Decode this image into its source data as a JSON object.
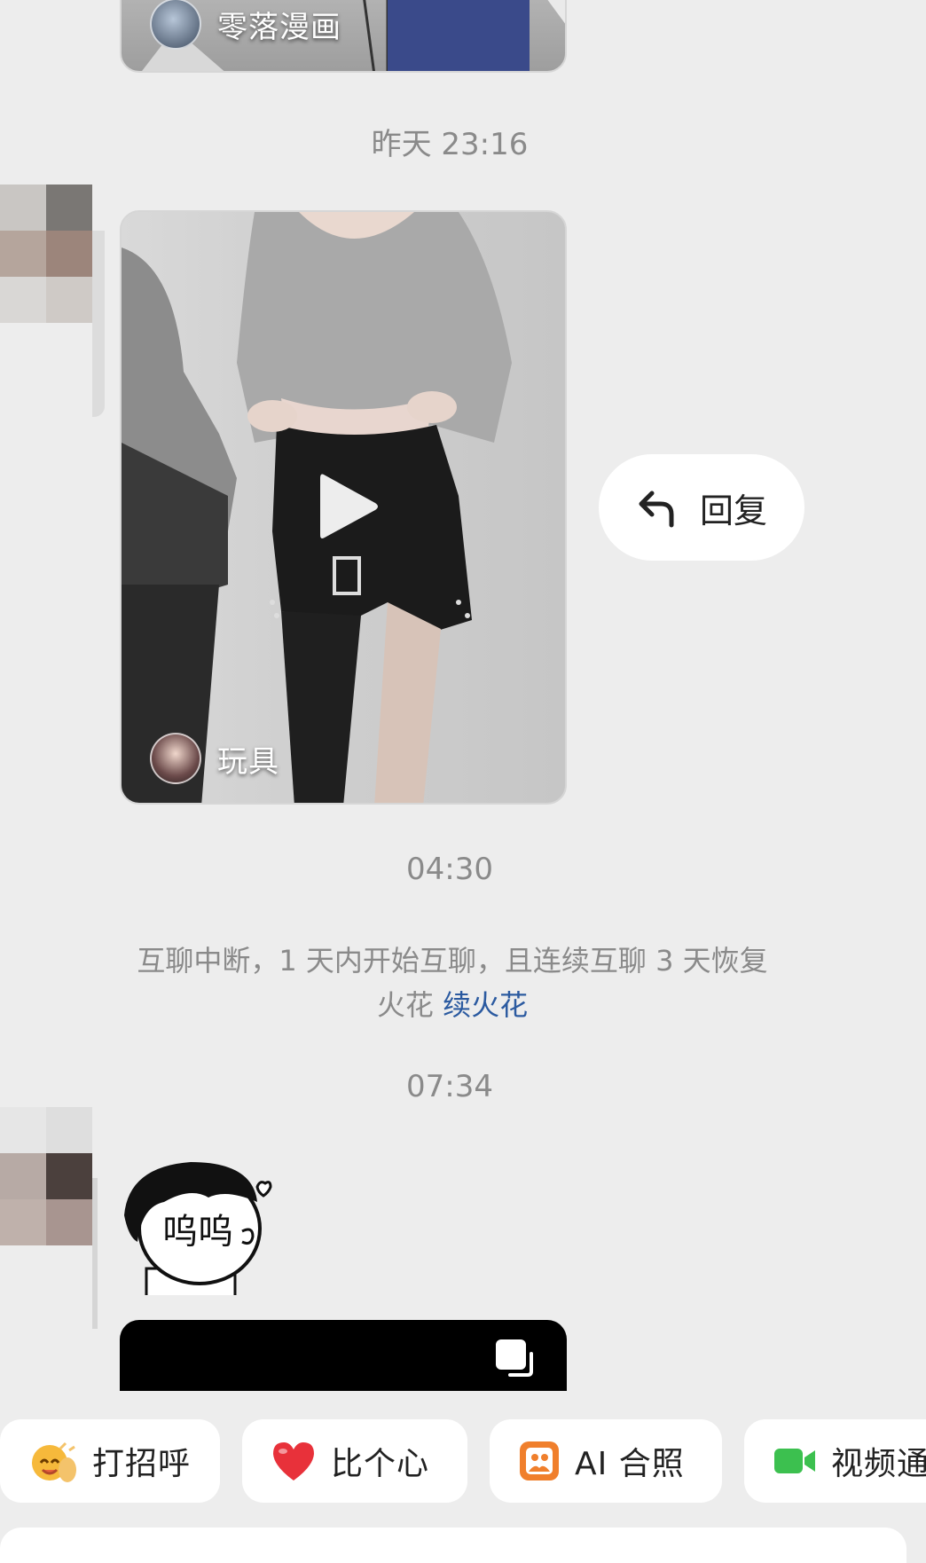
{
  "messages": {
    "top_video": {
      "author": "零落漫画"
    },
    "time_1": "昨天 23:16",
    "video": {
      "author": "玩具"
    },
    "reply_button": "回复",
    "time_2": "04:30",
    "system_notice": {
      "line1": "互聊中断，1 天内开始互聊，且连续互聊 3 天恢复",
      "line2_prefix": "火花 ",
      "link": "续火花"
    },
    "time_3": "07:34",
    "sticker_text": "呜呜"
  },
  "quick_actions": [
    {
      "label": "打招呼",
      "icon": "wave-emoji-icon"
    },
    {
      "label": "比个心",
      "icon": "heart-icon"
    },
    {
      "label": "AI 合照",
      "icon": "ai-photo-icon"
    },
    {
      "label": "视频通",
      "icon": "video-call-icon"
    }
  ],
  "colors": {
    "background": "#ededed",
    "link": "#2b5aa0",
    "heart": "#e8313a",
    "ai_photo": "#f07f2c",
    "video_call": "#3cc04f"
  }
}
